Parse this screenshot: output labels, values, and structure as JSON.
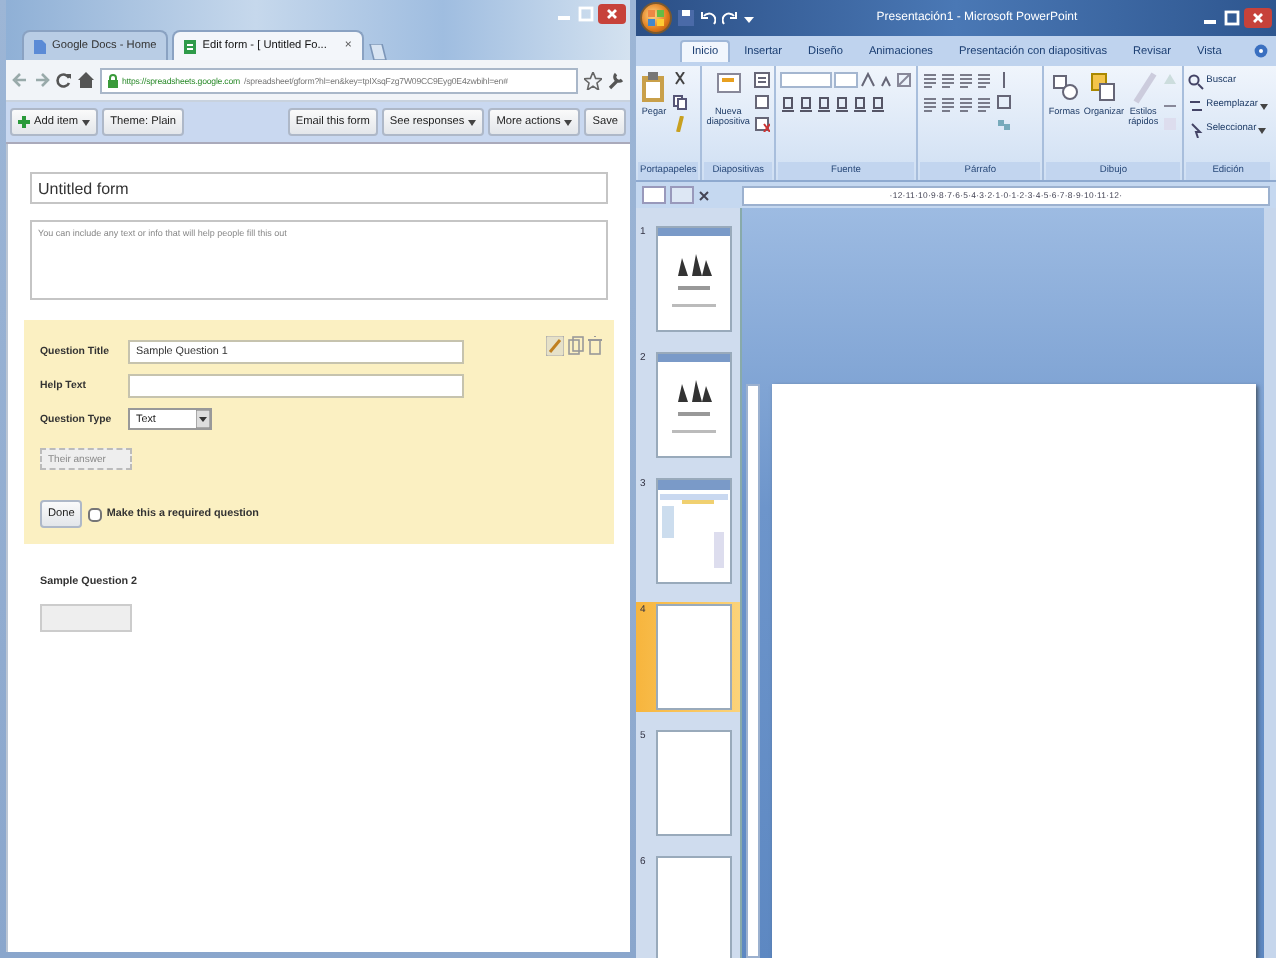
{
  "browser": {
    "tabs": [
      {
        "label": "Google Docs - Home",
        "selected": false
      },
      {
        "label": "Edit form - [ Untitled Fo...",
        "selected": true,
        "close": "×"
      }
    ],
    "url_host": "https://spreadsheets.google.com",
    "url_path": "/spreadsheet/gform?hl=en&key=tpIXsqFzg7W09CC9Eyg0E4zwbihl=en#",
    "toolbar_left": [
      {
        "label": "Add item",
        "menu": true
      },
      {
        "label": "Theme: Plain",
        "menu": false
      }
    ],
    "toolbar_right": [
      {
        "label": "Email this form",
        "menu": false
      },
      {
        "label": "See responses",
        "menu": true
      },
      {
        "label": "More actions",
        "menu": true
      },
      {
        "label": "Save",
        "menu": false
      }
    ],
    "form": {
      "title": "Untitled form",
      "description_placeholder": "You can include any text or info that will help people fill this out",
      "question": {
        "title_label": "Question Title",
        "title_value": "Sample Question 1",
        "help_label": "Help Text",
        "type_label": "Question Type",
        "type_value": "Text",
        "answer_placeholder": "Their answer",
        "done": "Done",
        "required": {
          "label": "Make this a required question",
          "checked": false
        }
      },
      "next_question": "Sample Question 2"
    }
  },
  "powerpoint": {
    "title": "Presentación1 - Microsoft PowerPoint",
    "tabs": [
      {
        "label": "Inicio",
        "selected": true
      },
      {
        "label": "Insertar",
        "selected": false
      },
      {
        "label": "Diseño",
        "selected": false
      },
      {
        "label": "Animaciones",
        "selected": false
      },
      {
        "label": "Presentación con diapositivas",
        "selected": false
      },
      {
        "label": "Revisar",
        "selected": false
      },
      {
        "label": "Vista",
        "selected": false
      }
    ],
    "groups": [
      {
        "kind": "clipboard",
        "label": "Portapapeles",
        "buttons": [
          "Pegar"
        ]
      },
      {
        "kind": "slides",
        "label": "Diapositivas",
        "buttons": [
          "Nueva diapositiva"
        ]
      },
      {
        "kind": "font",
        "label": "Fuente"
      },
      {
        "kind": "paragraph",
        "label": "Párrafo"
      },
      {
        "kind": "drawing",
        "label": "Dibujo",
        "buttons": [
          "Formas",
          "Organizar",
          "Estilos rápidos"
        ]
      },
      {
        "kind": "editing",
        "label": "Edición",
        "buttons": [
          "Buscar",
          "Reemplazar",
          "Seleccionar"
        ]
      }
    ],
    "ruler": "·12·11·10·9·8·7·6·5·4·3·2·1·0·1·2·3·4·5·6·7·8·9·10·11·12·",
    "slides": [
      {
        "number": "1",
        "kind": "figures",
        "selected": false
      },
      {
        "number": "2",
        "kind": "figures",
        "selected": false
      },
      {
        "number": "3",
        "kind": "screenshot",
        "selected": false
      },
      {
        "number": "4",
        "kind": "blank",
        "selected": true
      },
      {
        "number": "5",
        "kind": "blank",
        "selected": false
      },
      {
        "number": "6",
        "kind": "blank",
        "selected": false
      }
    ]
  }
}
